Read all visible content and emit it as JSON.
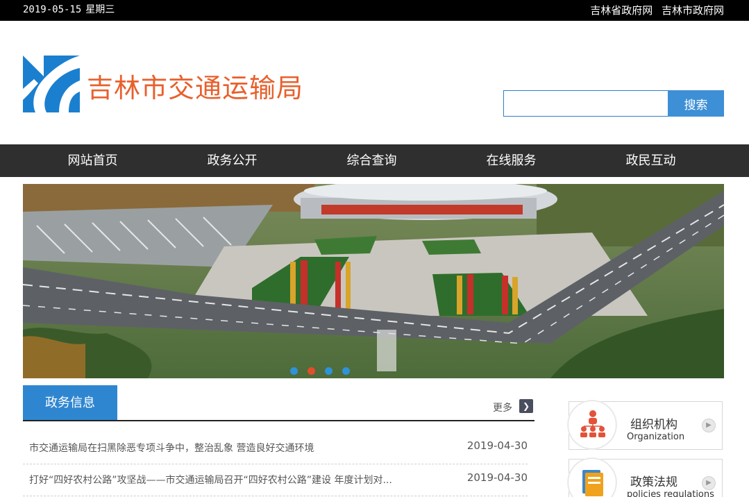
{
  "topbar": {
    "date": "2019-05-15",
    "weekday": "星期三",
    "links": [
      "吉林省政府网",
      "吉林市政府网"
    ]
  },
  "header": {
    "title": "吉林市交通运输局",
    "search_placeholder": "",
    "search_label": "搜索"
  },
  "nav": {
    "items": [
      "网站首页",
      "政务公开",
      "综合查询",
      "在线服务",
      "政民互动"
    ]
  },
  "banner": {
    "active_dot": 1
  },
  "news": {
    "tab_label": "政务信息",
    "more_label": "更多",
    "items": [
      {
        "title": "市交通运输局在扫黑除恶专项斗争中，整治乱象 营造良好交通环境",
        "date": "2019-04-30"
      },
      {
        "title": "打好“四好农村公路”攻坚战——市交通运输局召开“四好农村公路”建设 年度计划对...",
        "date": "2019-04-30"
      }
    ]
  },
  "side": {
    "cards": [
      {
        "cn": "组织机构",
        "en": "Organization",
        "icon": "org-chart-icon"
      },
      {
        "cn": "政策法规",
        "en": "policies regulations",
        "icon": "folder-icon"
      }
    ]
  },
  "colors": {
    "title_orange": "#e8602c",
    "accent_blue": "#2f86d0",
    "nav_bg": "#2f2f2f",
    "dot_active": "#e34d2a",
    "dot": "#2e93d8"
  }
}
